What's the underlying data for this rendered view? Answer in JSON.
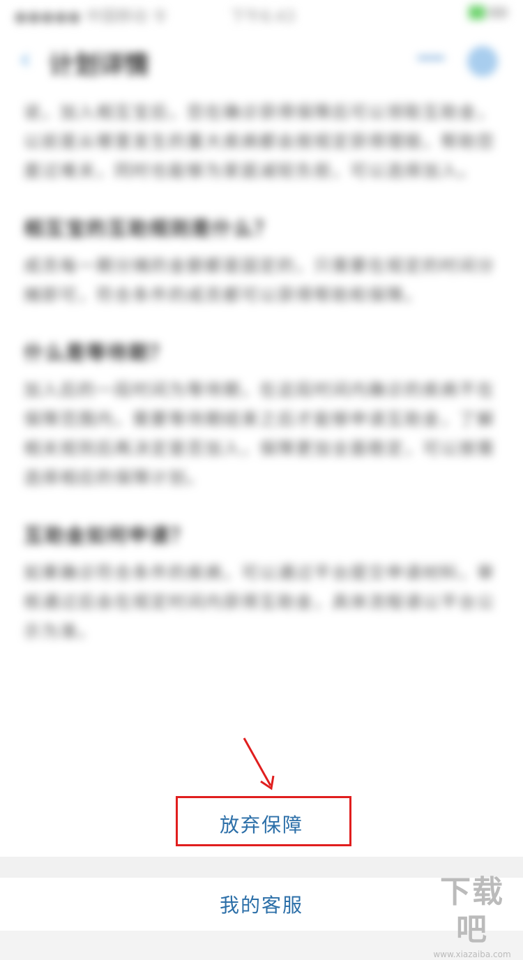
{
  "status_bar": {
    "carrier": "●●●●● 中国移动 令",
    "time": "下午6:43"
  },
  "nav": {
    "back_label": "‹",
    "title": "计划详情"
  },
  "article": {
    "para1": "说，加入相互宝后，您在确诊获得保障后可以领取互助金，以前是从哪里发生的重大疾病都会按规定获得理赔，帮助您度过难关，同时也能够为家庭减轻负担，可以选择加入。",
    "h1": "相互宝的互助规则是什么？",
    "para2": "成员每一期分摊的金额都是固定的，只需要在规定的时间分摊即可，符合条件的成员都可以获得帮助和保障。",
    "h2": "什么是等待期？",
    "para3": "加入后的一段时间为等待期，在这段时间内确诊的疾病不在保障范围内，需要等待期结束之后才能够申请互助金，了解相关规则后再决定是否加入，保障更加全面稳定，可以按需选择相应的保障计划。",
    "h3": "互助金如何申请？",
    "para4": "如果确诊符合条件的疾病，可以通过平台提交申请材料，审核通过后会在规定时间内获得互助金，具体流程请以平台公示为准。"
  },
  "sheet": {
    "abandon_label": "放弃保障",
    "service_label": "我的客服"
  },
  "watermark": {
    "logo": "下载吧",
    "url": "www.xiazaiba.com"
  },
  "colors": {
    "action_text": "#2c6fa8",
    "highlight": "#e01e1e"
  }
}
